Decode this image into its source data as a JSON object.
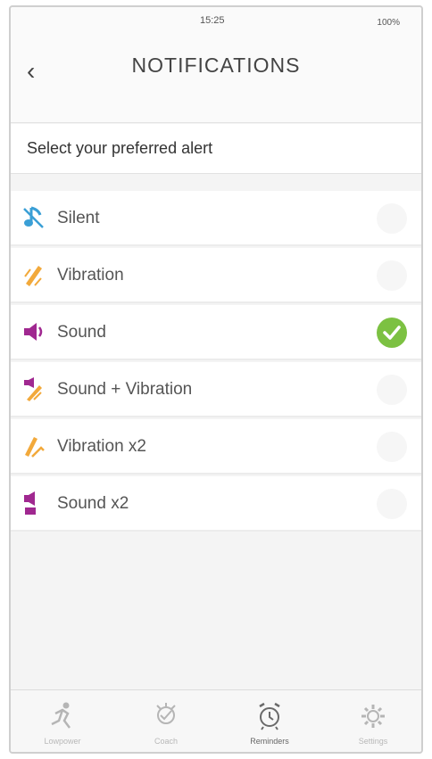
{
  "status_bar": {
    "time": "15:25",
    "battery": "100%"
  },
  "header": {
    "back_glyph": "‹",
    "title": "NOTIFICATIONS"
  },
  "prompt": "Select your preferred alert",
  "alerts": [
    {
      "label": "Silent",
      "icon": "muted-note-icon",
      "color": "#3a9fd6",
      "selected": false
    },
    {
      "label": "Vibration",
      "icon": "vibration-icon",
      "color": "#f2a93b",
      "selected": false
    },
    {
      "label": "Sound",
      "icon": "speaker-icon",
      "color": "#a02890",
      "selected": true
    },
    {
      "label": "Sound  + Vibration",
      "icon": "sound-vibration-icon",
      "color": "#a02890",
      "selected": false
    },
    {
      "label": "Vibration x2",
      "icon": "vibration-x2-icon",
      "color": "#f2a93b",
      "selected": false
    },
    {
      "label": "Sound x2",
      "icon": "sound-x2-icon",
      "color": "#a02890",
      "selected": false
    }
  ],
  "accent_check": "#7cc142",
  "tabs": [
    {
      "label": "Lowpower",
      "icon": "runner-icon",
      "active": false
    },
    {
      "label": "Coach",
      "icon": "coach-icon",
      "active": false
    },
    {
      "label": "Reminders",
      "icon": "alarm-clock-icon",
      "active": true
    },
    {
      "label": "Settings",
      "icon": "gear-icon",
      "active": false
    }
  ]
}
